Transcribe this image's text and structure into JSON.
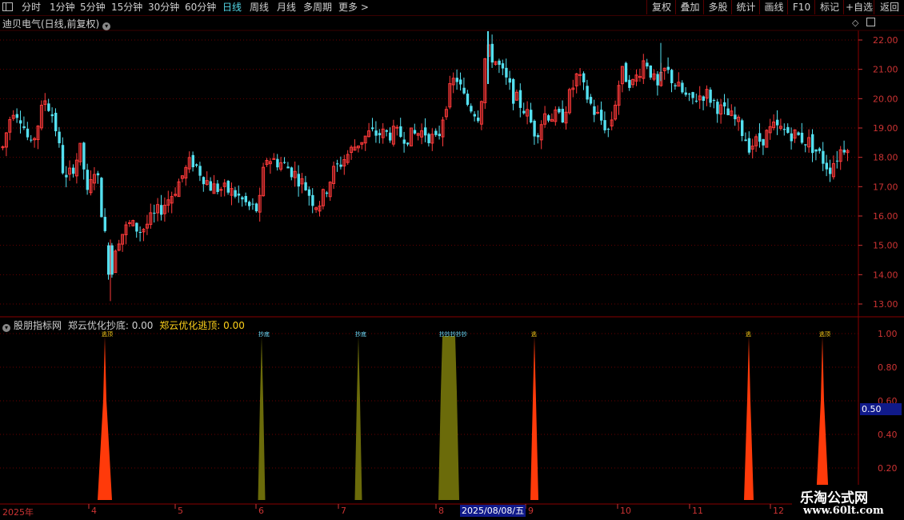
{
  "toolbar": {
    "periods": [
      "分时",
      "1分钟",
      "5分钟",
      "15分钟",
      "30分钟",
      "60分钟",
      "日线",
      "周线",
      "月线",
      "多周期",
      "更多 >"
    ],
    "active_period": "日线",
    "buttons": [
      "复权",
      "叠加",
      "多股",
      "统计",
      "画线",
      "F10",
      "标记",
      "+自选",
      "返回"
    ]
  },
  "main_panel": {
    "title": "迪贝电气(日线,前复权)",
    "price_ticks": [
      "22.00",
      "21.00",
      "20.00",
      "19.00",
      "18.00",
      "17.00",
      "16.00",
      "15.00",
      "14.00",
      "13.00"
    ]
  },
  "indicator_panel": {
    "source": "股朋指标网",
    "buy_label": "郑云优化抄底:",
    "buy_value": "0.00",
    "sell_label": "郑云优化逃顶:",
    "sell_value": "0.00",
    "y_ticks": [
      "1.00",
      "0.80",
      "0.60",
      "0.40",
      "0.20"
    ],
    "cursor_value": "0.50",
    "signal_tags": [
      "逃顶",
      "抄底",
      "抄底",
      "抄抄抄抄抄",
      "逃",
      "逃",
      "逃顶"
    ]
  },
  "x_axis": {
    "labels": [
      "2025年",
      "4",
      "5",
      "6",
      "7",
      "8",
      "9",
      "10",
      "11",
      "12"
    ],
    "cursor_date": "2025/08/08/五"
  },
  "colors": {
    "up": "#ff3a3a",
    "down": "#54e0f0",
    "sell": "#ff3a0a",
    "buy": "#6b6b0a",
    "grid": "#6a0000"
  },
  "watermark": {
    "line1": "乐淘公式网",
    "line2": "www.60lt.com"
  }
}
